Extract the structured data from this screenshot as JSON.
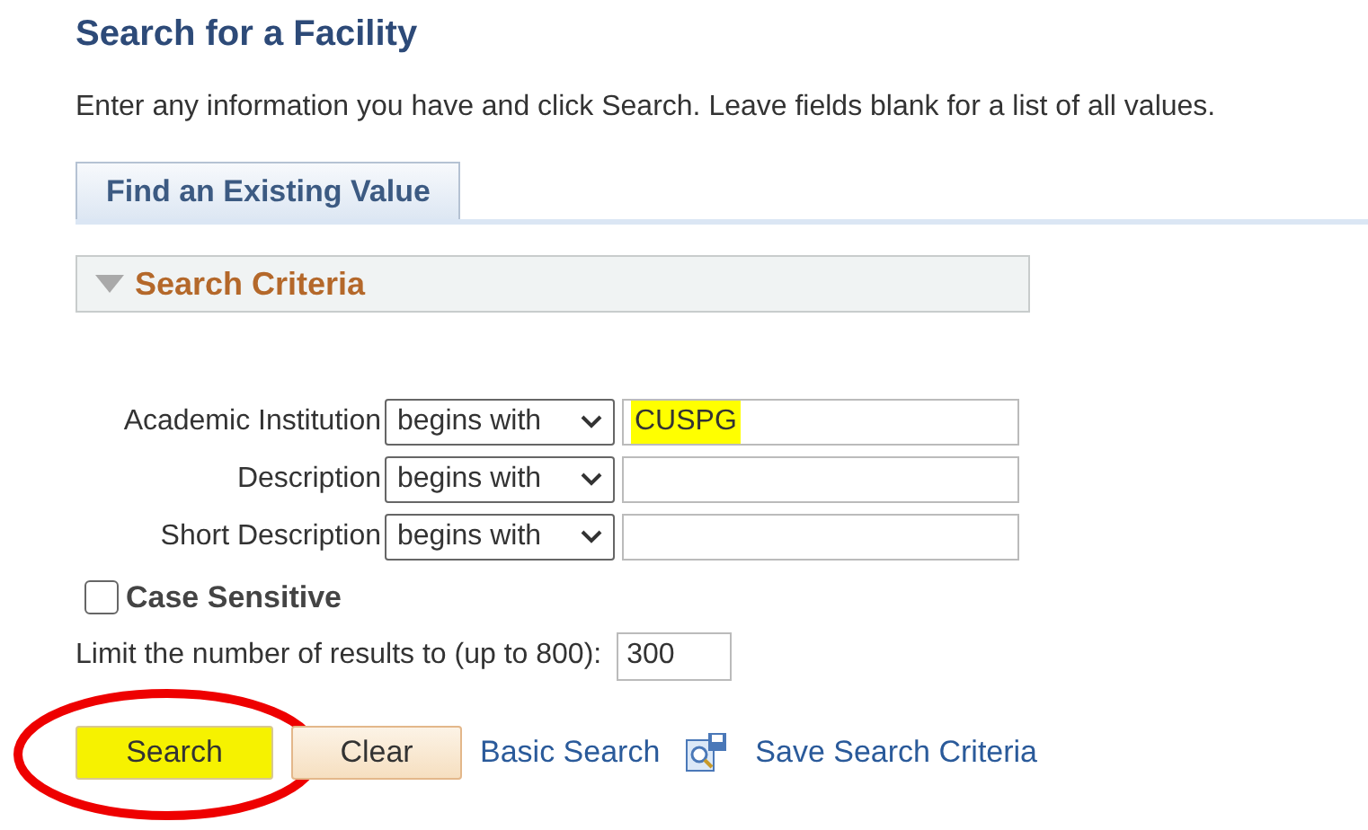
{
  "page": {
    "title": "Search for a Facility",
    "instructions": "Enter any information you have and click Search. Leave fields blank for a list of all values."
  },
  "tabs": [
    {
      "label": "Find an Existing Value",
      "selected": true
    }
  ],
  "section": {
    "title": "Search Criteria",
    "expanded": true
  },
  "fields": [
    {
      "label": "Academic Institution",
      "operator": "begins with",
      "value": "CUSPG",
      "highlighted": true
    },
    {
      "label": "Description",
      "operator": "begins with"
    },
    {
      "label": "Short Description",
      "operator": "begins with"
    }
  ],
  "case_sensitive": {
    "label": "Case Sensitive",
    "checked": false
  },
  "limit": {
    "label": "Limit the number of results to (up to 800):",
    "value": "300"
  },
  "buttons": [
    {
      "label": "Search",
      "highlighted": true,
      "circled": true
    },
    {
      "label": "Clear",
      "highlighted": false
    }
  ],
  "links": [
    {
      "label": "Basic Search",
      "kind": "plain"
    },
    {
      "label": "Save Search Criteria",
      "kind": "with-icon"
    }
  ]
}
